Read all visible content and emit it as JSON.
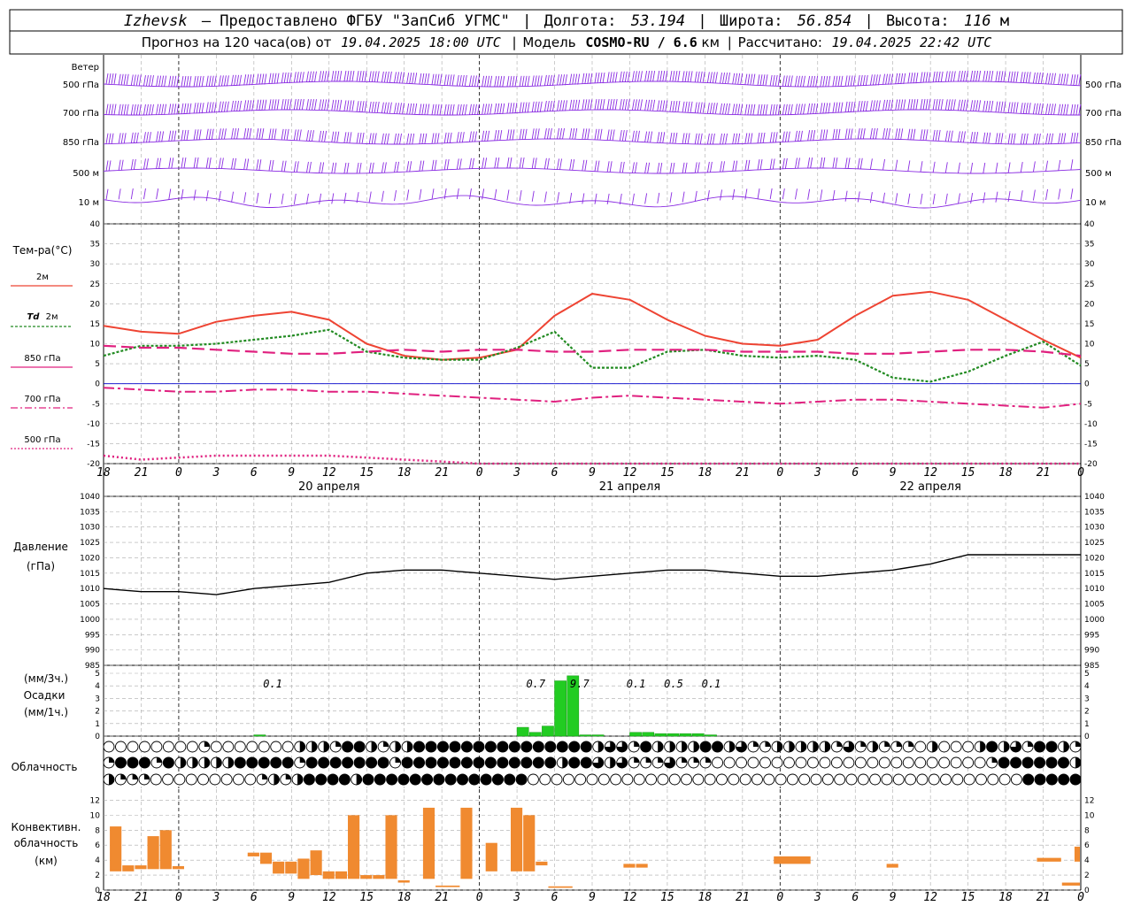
{
  "header": {
    "city": "Izhevsk",
    "provider": "— Предоставлено ФГБУ \"ЗапСиб УГМС\"",
    "lon_label": "Долгота:",
    "lon": "53.194",
    "lat_label": "Широта:",
    "lat": "56.854",
    "alt_label": "Высота:",
    "alt": "116",
    "alt_unit": "м",
    "forecast_label": "Прогноз на 120 часа(ов) от",
    "forecast_from": "19.04.2025 18:00 UTC",
    "model_label": "Модель",
    "model": "COSMO-RU / 6.6",
    "model_unit": "км",
    "computed_label": "Рассчитано:",
    "computed": "19.04.2025 22:42 UTC"
  },
  "colors": {
    "wind": "#8a2be2",
    "t2m": "#ee4433",
    "td2m": "#228b22",
    "t850": "#e0207f",
    "t700": "#e0207f",
    "t500": "#e0207f",
    "pressure": "#000000",
    "precip": "#22cc22",
    "conv": "#f08a30",
    "grid": "#aaaaaa",
    "zero_line": "#0000cc"
  },
  "labels": {
    "wind": "Ветер",
    "wind_levels": [
      "500 гПа",
      "700 гПа",
      "850 гПа",
      "500 м",
      "10 м"
    ],
    "temp_title": "Тем-ра(°С)",
    "temp_2m": "2м",
    "temp_td": "Td",
    "temp_td2": "2м",
    "temp_850": "850 гПа",
    "temp_700": "700 гПа",
    "temp_500": "500 гПа",
    "pressure_title": "Давление",
    "pressure_unit": "(гПа)",
    "precip_unit1": "(мм/3ч.)",
    "precip_title": "Осадки",
    "precip_unit2": "(мм/1ч.)",
    "cloud_title": "Облачность",
    "conv_title1": "Конвективн.",
    "conv_title2": "облачность",
    "conv_unit": "(км)"
  },
  "x_ticks": [
    "18",
    "21",
    "0",
    "3",
    "6",
    "9",
    "12",
    "15",
    "18",
    "21",
    "0",
    "3",
    "6",
    "9",
    "12",
    "15",
    "18",
    "21",
    "0",
    "3",
    "6",
    "9",
    "12",
    "15",
    "18",
    "21",
    "0"
  ],
  "date_labels": [
    {
      "text": "20 апреля",
      "hour": 18
    },
    {
      "text": "21 апреля",
      "hour": 42
    },
    {
      "text": "22 апреля",
      "hour": 66
    }
  ],
  "chart_data": [
    {
      "type": "line",
      "title": "Тем-ра(°С)",
      "x_hours_from_start": [
        0,
        3,
        6,
        9,
        12,
        15,
        18,
        21,
        24,
        27,
        30,
        33,
        36,
        39,
        42,
        45,
        48,
        51,
        54,
        57,
        60,
        63,
        66,
        69,
        72,
        75,
        78
      ],
      "ylim": [
        -20,
        40
      ],
      "y_ticks": [
        -20,
        -15,
        -10,
        -5,
        0,
        5,
        10,
        15,
        20,
        25,
        30,
        35,
        40
      ],
      "series": [
        {
          "name": "2м",
          "values": [
            14.5,
            13,
            12.5,
            15.5,
            17,
            18,
            16,
            10,
            7,
            6,
            6.5,
            8.5,
            17,
            22.5,
            21,
            16,
            12,
            10,
            9.5,
            11,
            17,
            22,
            23,
            21,
            16,
            11,
            6.5
          ]
        },
        {
          "name": "Td 2м",
          "values": [
            7,
            9.5,
            9.5,
            10,
            11,
            12,
            13.5,
            8,
            6.5,
            6,
            6,
            9,
            13,
            4,
            4,
            8,
            8.5,
            7,
            6.5,
            7,
            6,
            1.5,
            0.5,
            3,
            7,
            10.5,
            4.5
          ]
        },
        {
          "name": "850 гПа",
          "values": [
            9.5,
            9,
            9,
            8.5,
            8,
            7.5,
            7.5,
            8,
            8.5,
            8,
            8.5,
            8.5,
            8,
            8,
            8.5,
            8.5,
            8.5,
            8,
            8,
            8,
            7.5,
            7.5,
            8,
            8.5,
            8.5,
            8,
            7
          ]
        },
        {
          "name": "700 гПа",
          "values": [
            -1,
            -1.5,
            -2,
            -2,
            -1.5,
            -1.5,
            -2,
            -2,
            -2.5,
            -3,
            -3.5,
            -4,
            -4.5,
            -3.5,
            -3,
            -3.5,
            -4,
            -4.5,
            -5,
            -4.5,
            -4,
            -4,
            -4.5,
            -5,
            -5.5,
            -6,
            -5
          ]
        },
        {
          "name": "500 гПа",
          "values": [
            -18,
            -19,
            -18.5,
            -18,
            -18,
            -18,
            -18,
            -18.5,
            -19,
            -19.5,
            -20,
            -22,
            -24,
            -25,
            -25,
            -25,
            -25,
            -25,
            -25,
            -25,
            -25,
            -25,
            -25,
            -25,
            -25,
            -25,
            -25
          ]
        }
      ]
    },
    {
      "type": "line",
      "title": "Давление",
      "x_hours_from_start": [
        0,
        3,
        6,
        9,
        12,
        15,
        18,
        21,
        24,
        27,
        30,
        33,
        36,
        39,
        42,
        45,
        48,
        51,
        54,
        57,
        60,
        63,
        66,
        69,
        72,
        75,
        78
      ],
      "ylim": [
        985,
        1040
      ],
      "y_ticks": [
        985,
        990,
        995,
        1000,
        1005,
        1010,
        1015,
        1020,
        1025,
        1030,
        1035,
        1040
      ],
      "series": [
        {
          "name": "",
          "values": [
            1010,
            1009,
            1009,
            1008,
            1010,
            1011,
            1012,
            1015,
            1016,
            1016,
            1015,
            1014,
            1013,
            1014,
            1015,
            1016,
            1016,
            1015,
            1014,
            1014,
            1015,
            1016,
            1018,
            1021,
            1021,
            1021,
            1021
          ]
        }
      ]
    },
    {
      "type": "bar",
      "title": "Осадки",
      "ylim": [
        0,
        5
      ],
      "y_ticks": [
        0,
        1,
        2,
        3,
        4,
        5
      ],
      "hours": [
        12,
        33,
        34,
        35,
        36,
        37,
        38,
        39,
        42,
        43,
        44,
        45,
        46,
        47,
        48
      ],
      "values": [
        0.1,
        0.7,
        0.3,
        0.8,
        4.4,
        4.8,
        0.1,
        0.1,
        0.3,
        0.3,
        0.2,
        0.2,
        0.2,
        0.2,
        0.1
      ],
      "annotations": [
        {
          "hour": 13.5,
          "text": "0.1"
        },
        {
          "hour": 34.5,
          "text": "0.7"
        },
        {
          "hour": 38,
          "text": "9.7"
        },
        {
          "hour": 42.5,
          "text": "0.1"
        },
        {
          "hour": 45.5,
          "text": "0.5"
        },
        {
          "hour": 48.5,
          "text": "0.1"
        }
      ]
    },
    {
      "type": "bar",
      "title": "Конвективн. облачность",
      "ylim": [
        0,
        13
      ],
      "y_ticks": [
        0,
        2,
        4,
        6,
        8,
        10,
        12
      ],
      "segments": [
        {
          "h0": 0.5,
          "h1": 1.5,
          "bottom": 2.5,
          "top": 8.5
        },
        {
          "h0": 1.5,
          "h1": 2.5,
          "bottom": 2.5,
          "top": 3.3
        },
        {
          "h0": 2.5,
          "h1": 3.5,
          "bottom": 2.8,
          "top": 3.3
        },
        {
          "h0": 3.5,
          "h1": 4.5,
          "bottom": 2.8,
          "top": 7.2
        },
        {
          "h0": 4.5,
          "h1": 5.5,
          "bottom": 2.8,
          "top": 8
        },
        {
          "h0": 5.5,
          "h1": 6.5,
          "bottom": 2.8,
          "top": 3.2
        },
        {
          "h0": 11.5,
          "h1": 12.5,
          "bottom": 4.5,
          "top": 5
        },
        {
          "h0": 12.5,
          "h1": 13.5,
          "bottom": 3.5,
          "top": 5
        },
        {
          "h0": 13.5,
          "h1": 14.5,
          "bottom": 2.2,
          "top": 3.8
        },
        {
          "h0": 14.5,
          "h1": 15.5,
          "bottom": 2.2,
          "top": 3.8
        },
        {
          "h0": 15.5,
          "h1": 16.5,
          "bottom": 1.5,
          "top": 4.2
        },
        {
          "h0": 16.5,
          "h1": 17.5,
          "bottom": 2,
          "top": 5.3
        },
        {
          "h0": 17.5,
          "h1": 18.5,
          "bottom": 1.5,
          "top": 2.5
        },
        {
          "h0": 18.5,
          "h1": 19.5,
          "bottom": 1.5,
          "top": 2.5
        },
        {
          "h0": 19.5,
          "h1": 20.5,
          "bottom": 1.5,
          "top": 10
        },
        {
          "h0": 20.5,
          "h1": 21.5,
          "bottom": 1.5,
          "top": 2
        },
        {
          "h0": 21.5,
          "h1": 22.5,
          "bottom": 1.5,
          "top": 2
        },
        {
          "h0": 22.5,
          "h1": 23.5,
          "bottom": 1.5,
          "top": 10
        },
        {
          "h0": 23.5,
          "h1": 24.5,
          "bottom": 1,
          "top": 1.3
        },
        {
          "h0": 25.5,
          "h1": 26.5,
          "bottom": 1.5,
          "top": 11
        },
        {
          "h0": 26.5,
          "h1": 28.5,
          "bottom": 0.4,
          "top": 0.6
        },
        {
          "h0": 28.5,
          "h1": 29.5,
          "bottom": 1.5,
          "top": 11
        },
        {
          "h0": 30.5,
          "h1": 31.5,
          "bottom": 2.5,
          "top": 6.3
        },
        {
          "h0": 32.5,
          "h1": 33.5,
          "bottom": 2.5,
          "top": 11
        },
        {
          "h0": 33.5,
          "h1": 34.5,
          "bottom": 2.5,
          "top": 10
        },
        {
          "h0": 34.5,
          "h1": 35.5,
          "bottom": 3.3,
          "top": 3.8
        },
        {
          "h0": 35.5,
          "h1": 37.5,
          "bottom": 0.3,
          "top": 0.5
        },
        {
          "h0": 41.5,
          "h1": 42.5,
          "bottom": 3,
          "top": 3.5
        },
        {
          "h0": 42.5,
          "h1": 43.5,
          "bottom": 3,
          "top": 3.5
        },
        {
          "h0": 53.5,
          "h1": 56.5,
          "bottom": 3.5,
          "top": 4.5
        },
        {
          "h0": 62.5,
          "h1": 63.5,
          "bottom": 3,
          "top": 3.5
        },
        {
          "h0": 74.5,
          "h1": 76.5,
          "bottom": 3.8,
          "top": 4.3
        },
        {
          "h0": 76.5,
          "h1": 78,
          "bottom": 0.6,
          "top": 1
        },
        {
          "h0": 77.5,
          "h1": 78,
          "bottom": 3.8,
          "top": 5.8
        }
      ]
    }
  ],
  "clouds": {
    "rows": [
      "ooooooooqooooooohhhqbbhqhhbbbbbbbbbbbbbbbhttqbhhhhbbhtqqhhhhhqtqhqqqohooohbhtqbbhq",
      "qbbbqbhhhhhbbbbbqbbbbbbbqbbbbbbbbbbbbbhbbthtqqqtqqqoooooooooooooooooooooooqbbbbbbh",
      "hqqqoooooooooqhqhbbbbhbbbbbbbbbbbbbboooooooooooooooooooooooooooooooooooooooooobbbbb"
    ]
  }
}
